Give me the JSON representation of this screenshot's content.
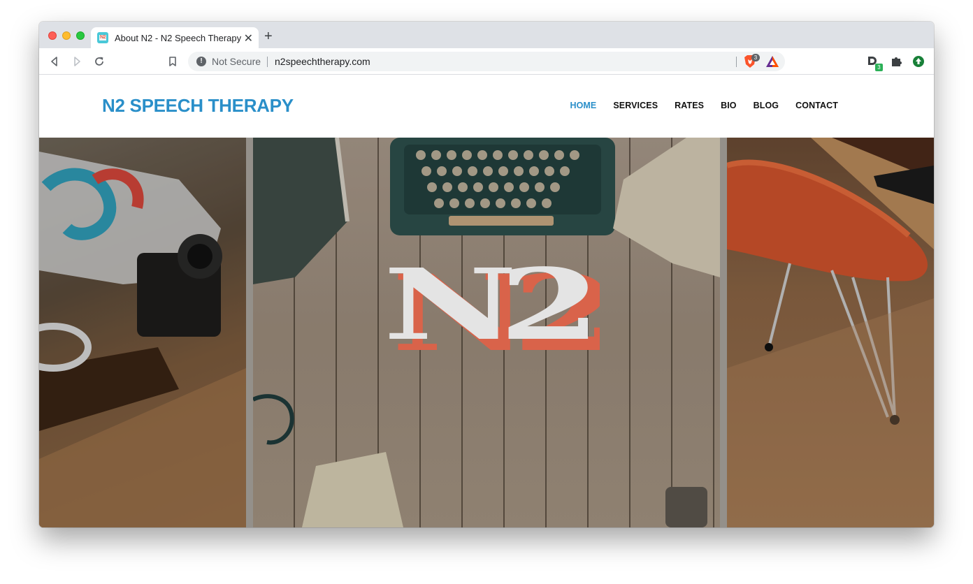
{
  "browser": {
    "tab": {
      "title": "About N2 - N2 Speech Therapy",
      "favicon_text": "N2"
    },
    "omnibox": {
      "security_label": "Not Secure",
      "url": "n2speechtherapy.com"
    },
    "brave_shield_count": "3",
    "extension_badge_count": "3",
    "icons": {
      "back": "back-arrow-icon",
      "forward": "forward-arrow-icon",
      "reload": "reload-icon",
      "bookmark": "bookmark-icon",
      "security": "info-icon",
      "brave": "brave-lion-icon",
      "rewards": "bat-triangle-icon",
      "extensions": "puzzle-icon",
      "update": "update-arrow-icon"
    }
  },
  "site": {
    "logo_text": "N2 SPEECH THERAPY",
    "nav": [
      {
        "label": "HOME",
        "active": true
      },
      {
        "label": "SERVICES",
        "active": false
      },
      {
        "label": "RATES",
        "active": false
      },
      {
        "label": "BIO",
        "active": false
      },
      {
        "label": "BLOG",
        "active": false
      },
      {
        "label": "CONTACT",
        "active": false
      }
    ],
    "colors": {
      "brand_blue": "#2a8fc9",
      "logo_coral": "#d9634a",
      "logo_light": "#e4e4e4"
    },
    "hero": {
      "logo_text": "N2"
    }
  }
}
